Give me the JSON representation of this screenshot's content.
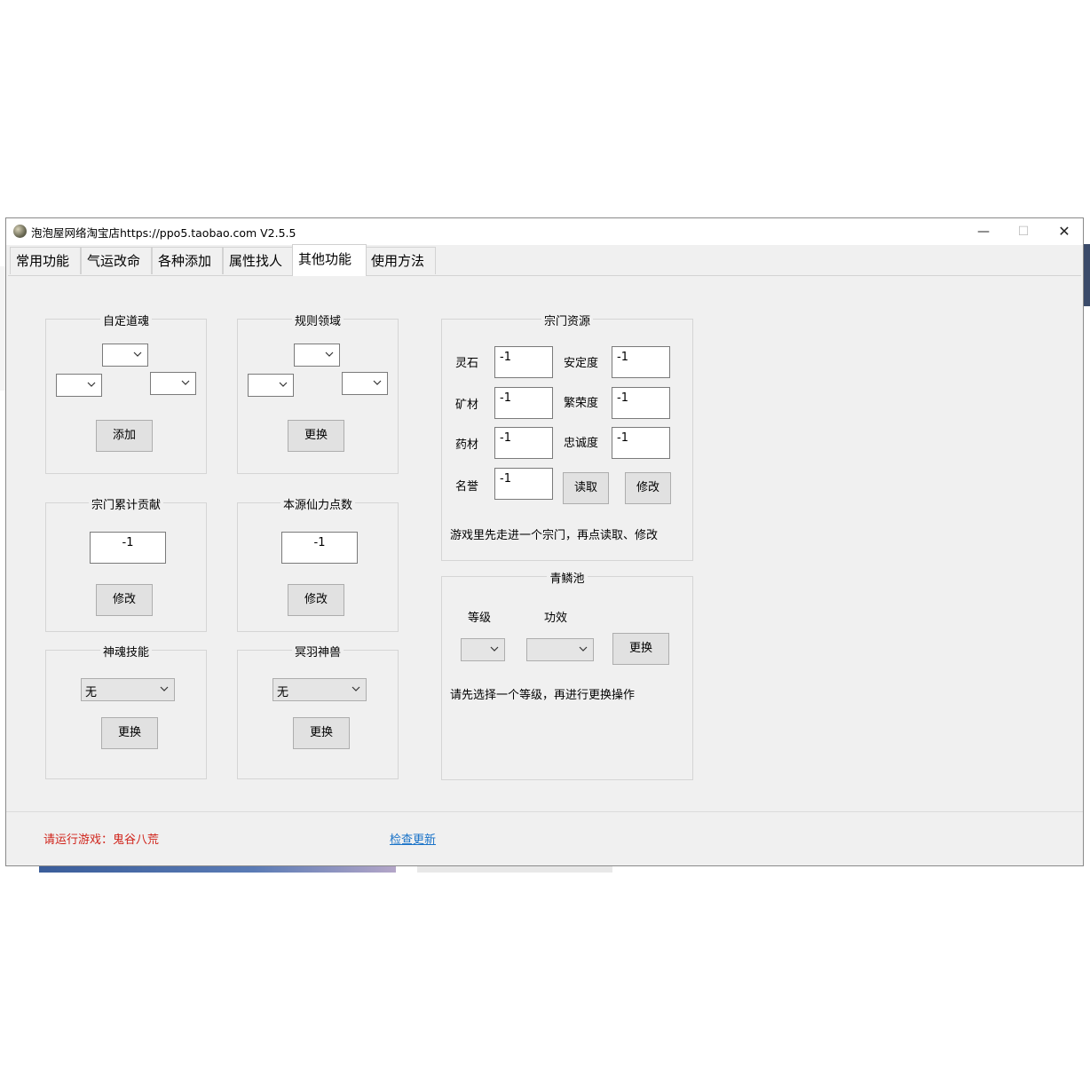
{
  "window": {
    "title": "泡泡屋网络淘宝店https://ppo5.taobao.com  V2.5.5",
    "controls": {
      "minimize": "—",
      "maximize": "☐",
      "close": "✕"
    }
  },
  "tabs": [
    {
      "label": "常用功能",
      "active": false
    },
    {
      "label": "气运改命",
      "active": false
    },
    {
      "label": "各种添加",
      "active": false
    },
    {
      "label": "属性找人",
      "active": false
    },
    {
      "label": "其他功能",
      "active": true
    },
    {
      "label": "使用方法",
      "active": false
    }
  ],
  "groups": {
    "custom_dao_soul": {
      "title": "自定道魂",
      "button": "添加"
    },
    "rule_domain": {
      "title": "规则领域",
      "button": "更换"
    },
    "sect_contribution": {
      "title": "宗门累计贡献",
      "value": "-1",
      "button": "修改"
    },
    "origin_power": {
      "title": "本源仙力点数",
      "value": "-1",
      "button": "修改"
    },
    "soul_skill": {
      "title": "神魂技能",
      "selected": "无",
      "button": "更换"
    },
    "nether_beast": {
      "title": "冥羽神兽",
      "selected": "无",
      "button": "更换"
    },
    "sect_resources": {
      "title": "宗门资源",
      "fields": {
        "spirit_stone": {
          "label": "灵石",
          "value": "-1"
        },
        "stability": {
          "label": "安定度",
          "value": "-1"
        },
        "ore": {
          "label": "矿材",
          "value": "-1"
        },
        "prosperity": {
          "label": "繁荣度",
          "value": "-1"
        },
        "herbs": {
          "label": "药材",
          "value": "-1"
        },
        "loyalty": {
          "label": "忠诚度",
          "value": "-1"
        },
        "reputation": {
          "label": "名誉",
          "value": "-1"
        }
      },
      "read_button": "读取",
      "modify_button": "修改",
      "hint": "游戏里先走进一个宗门，再点读取、修改"
    },
    "scale_pool": {
      "title": "青鳞池",
      "level_label": "等级",
      "effect_label": "功效",
      "button": "更换",
      "hint": "请先选择一个等级，再进行更换操作"
    }
  },
  "status": {
    "message": "请运行游戏：鬼谷八荒",
    "check_update": "检查更新"
  },
  "colors": {
    "status_red": "#d0241b",
    "link_blue": "#1a73c8",
    "window_bg": "#f0f0f0"
  }
}
